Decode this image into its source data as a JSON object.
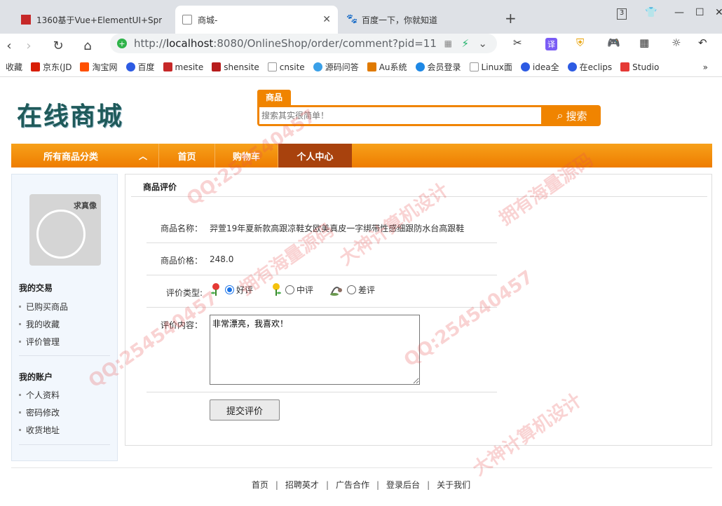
{
  "browser": {
    "tabs": [
      {
        "title": "1360基于Vue+ElementUI+Spr"
      },
      {
        "title": "商城-"
      },
      {
        "title": "百度一下，你就知道"
      }
    ],
    "url_prefix": "http://",
    "url_host": "localhost",
    "url_path": ":8080/OnlineShop/order/comment?pid=11",
    "bookmarks": [
      "收藏",
      "京东(JD",
      "淘宝网",
      "百度",
      "mesite",
      "shensite",
      "cnsite",
      "源码问答",
      "Au系统",
      "会员登录",
      "Linux面",
      "idea全",
      "在eclips",
      "Studio"
    ]
  },
  "shop": {
    "logo": "在线商城",
    "search": {
      "tab_label": "商品",
      "placeholder": "搜索其实很简单！",
      "button_label": "搜索"
    },
    "nav": {
      "category_label": "所有商品分类",
      "items": [
        "首页",
        "购物车",
        "个人中心"
      ]
    }
  },
  "sidebar": {
    "avatar_tag": "求真像",
    "sections": [
      {
        "title": "我的交易",
        "links": [
          "已购买商品",
          "我的收藏",
          "评价管理"
        ]
      },
      {
        "title": "我的账户",
        "links": [
          "个人资料",
          "密码修改",
          "收货地址"
        ]
      }
    ]
  },
  "review": {
    "title": "商品评价",
    "name_label": "商品名称：",
    "name_value": "羿萱19年夏新款高跟凉鞋女欧美真皮一字绑带性感细跟防水台高跟鞋",
    "price_label": "商品价格：",
    "price_value": "248.0",
    "type_label": "评价类型:",
    "types": [
      "好评",
      "中评",
      "差评"
    ],
    "selected_type": "好评",
    "content_label": "评价内容：",
    "content_value": "非常漂亮，我喜欢！",
    "submit_label": "提交评价"
  },
  "footer": {
    "links": [
      "首页",
      "招聘英才",
      "广告合作",
      "登录后台",
      "关于我们"
    ]
  },
  "watermarks": [
    "QQ:254540457",
    "拥有海量源码",
    "大神计算机设计"
  ]
}
